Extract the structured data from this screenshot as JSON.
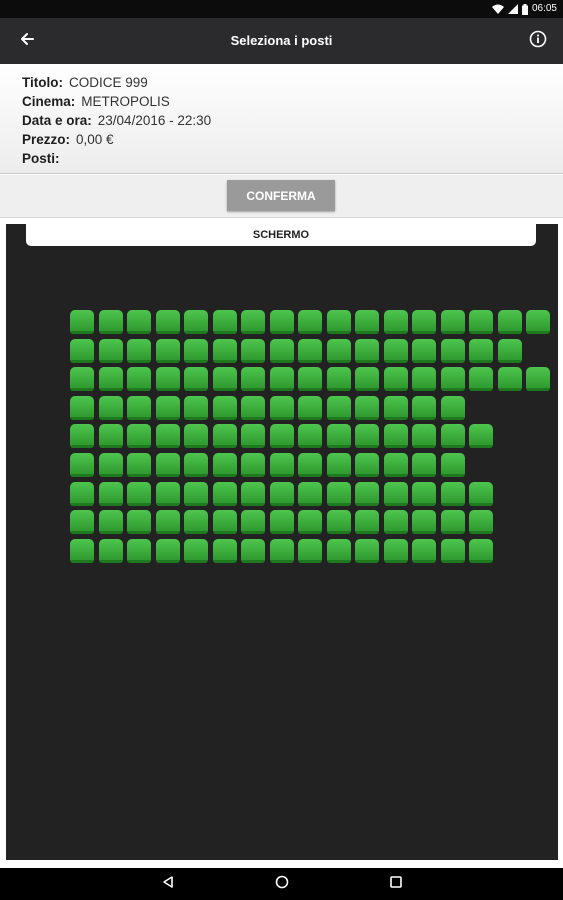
{
  "status_bar": {
    "time": "06:05",
    "icons": [
      "wifi-icon",
      "signal-icon",
      "battery-icon"
    ]
  },
  "app_bar": {
    "title": "Seleziona i posti",
    "back_icon": "arrow-left-icon",
    "info_icon": "info-icon"
  },
  "details": {
    "rows": [
      {
        "label": "Titolo:",
        "value": "CODICE 999"
      },
      {
        "label": "Cinema:",
        "value": "METROPOLIS"
      },
      {
        "label": "Data e ora:",
        "value": "23/04/2016 - 22:30"
      },
      {
        "label": "Prezzo:",
        "value": "0,00 €"
      },
      {
        "label": "Posti:",
        "value": ""
      }
    ]
  },
  "actions": {
    "confirm_label": "CONFERMA"
  },
  "seat_map": {
    "screen_label": "SCHERMO",
    "seat_color": "#3cb43c",
    "rows": [
      {
        "seats": [
          1,
          1,
          1,
          1,
          1,
          1,
          1,
          1,
          1,
          1,
          1,
          1,
          1,
          1,
          1,
          1,
          1
        ]
      },
      {
        "seats": [
          1,
          1,
          1,
          1,
          1,
          1,
          1,
          1,
          1,
          1,
          1,
          1,
          1,
          1,
          1,
          1,
          0
        ]
      },
      {
        "seats": [
          1,
          1,
          1,
          1,
          1,
          1,
          1,
          1,
          1,
          1,
          1,
          1,
          1,
          1,
          1,
          1,
          1
        ]
      },
      {
        "seats": [
          1,
          1,
          1,
          1,
          1,
          1,
          1,
          1,
          1,
          1,
          1,
          1,
          1,
          1,
          0,
          0,
          0
        ]
      },
      {
        "seats": [
          1,
          1,
          1,
          1,
          1,
          1,
          1,
          1,
          1,
          1,
          1,
          1,
          1,
          1,
          1,
          0,
          0
        ]
      },
      {
        "seats": [
          1,
          1,
          1,
          1,
          1,
          1,
          1,
          1,
          1,
          1,
          1,
          1,
          1,
          1,
          0,
          0,
          0
        ]
      },
      {
        "seats": [
          1,
          1,
          1,
          1,
          1,
          1,
          1,
          1,
          1,
          1,
          1,
          1,
          1,
          1,
          1,
          0,
          0
        ]
      },
      {
        "seats": [
          1,
          1,
          1,
          1,
          1,
          1,
          1,
          1,
          1,
          1,
          1,
          1,
          1,
          1,
          1,
          0,
          0
        ]
      },
      {
        "seats": [
          1,
          1,
          1,
          1,
          1,
          1,
          1,
          1,
          1,
          1,
          1,
          1,
          1,
          1,
          1,
          0,
          0
        ]
      }
    ]
  },
  "nav_bar": {
    "buttons": [
      "back-triangle-icon",
      "home-circle-icon",
      "recents-square-icon"
    ]
  }
}
